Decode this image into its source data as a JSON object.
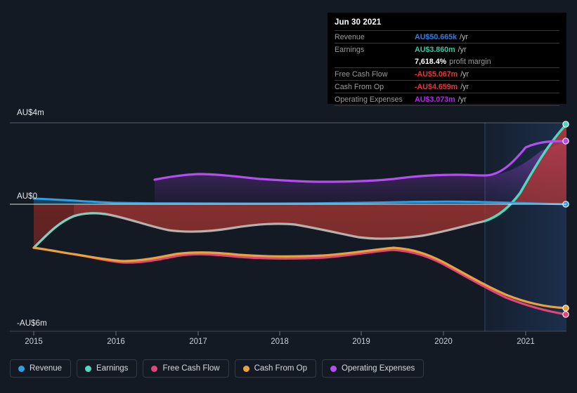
{
  "chart_data": {
    "type": "area",
    "title": "",
    "xlabel": "",
    "ylabel": "",
    "currency": "AU$",
    "grid": true,
    "legend_position": "bottom",
    "y_ticks": [
      {
        "label": "AU$4m",
        "value": 4000000
      },
      {
        "label": "AU$0",
        "value": 0
      },
      {
        "label": "-AU$6m",
        "value": -6000000
      }
    ],
    "ylim": [
      -6000000,
      4000000
    ],
    "x_ticks": [
      "2015",
      "2016",
      "2017",
      "2018",
      "2019",
      "2020",
      "2021"
    ],
    "xlim": [
      "2015",
      "2021.5"
    ],
    "forecast_region": {
      "from": "2020.72",
      "to": "2021.5",
      "shaded": true
    },
    "series": [
      {
        "name": "Revenue",
        "color": "#2e9fe0",
        "fill": "#2e9fe0",
        "points": [
          {
            "x": 2015.0,
            "y": 0.28
          },
          {
            "x": 2015.5,
            "y": 0.2
          },
          {
            "x": 2016.0,
            "y": 0.05
          },
          {
            "x": 2017.0,
            "y": 0.03
          },
          {
            "x": 2018.0,
            "y": 0.03
          },
          {
            "x": 2019.0,
            "y": 0.04
          },
          {
            "x": 2019.5,
            "y": 0.06
          },
          {
            "x": 2020.0,
            "y": 0.08
          },
          {
            "x": 2020.5,
            "y": 0.07
          },
          {
            "x": 2021.0,
            "y": 0.05
          },
          {
            "x": 2021.5,
            "y": 0.05
          }
        ]
      },
      {
        "name": "Earnings",
        "color": "#4ed8c0",
        "fill": "#b7302e",
        "points": [
          {
            "x": 2015.0,
            "y": -2.55
          },
          {
            "x": 2015.6,
            "y": -1.4
          },
          {
            "x": 2016.0,
            "y": -1.2
          },
          {
            "x": 2016.5,
            "y": -1.48
          },
          {
            "x": 2017.0,
            "y": -1.6
          },
          {
            "x": 2017.5,
            "y": -1.5
          },
          {
            "x": 2018.0,
            "y": -1.38
          },
          {
            "x": 2018.5,
            "y": -1.3
          },
          {
            "x": 2019.0,
            "y": -1.46
          },
          {
            "x": 2019.5,
            "y": -1.62
          },
          {
            "x": 2020.0,
            "y": -1.7
          },
          {
            "x": 2020.4,
            "y": -1.58
          },
          {
            "x": 2020.8,
            "y": -1.1
          },
          {
            "x": 2021.1,
            "y": 0.6
          },
          {
            "x": 2021.5,
            "y": 3.86
          }
        ]
      },
      {
        "name": "Free Cash Flow",
        "color": "#e0457b",
        "fill": "#e0457b",
        "points": [
          {
            "x": 2015.4,
            "y": -2.7
          },
          {
            "x": 2016.0,
            "y": -3.0
          },
          {
            "x": 2016.6,
            "y": -2.55
          },
          {
            "x": 2017.0,
            "y": -2.5
          },
          {
            "x": 2017.5,
            "y": -2.72
          },
          {
            "x": 2018.0,
            "y": -2.78
          },
          {
            "x": 2018.5,
            "y": -2.74
          },
          {
            "x": 2019.0,
            "y": -2.7
          },
          {
            "x": 2019.5,
            "y": -2.52
          },
          {
            "x": 2020.0,
            "y": -2.6
          },
          {
            "x": 2020.5,
            "y": -3.3
          },
          {
            "x": 2021.0,
            "y": -4.3
          },
          {
            "x": 2021.5,
            "y": -5.07
          }
        ]
      },
      {
        "name": "Cash From Op",
        "color": "#e8a33d",
        "fill": "#e8a33d",
        "points": [
          {
            "x": 2015.0,
            "y": -2.55
          },
          {
            "x": 2015.5,
            "y": -2.72
          },
          {
            "x": 2016.0,
            "y": -2.92
          },
          {
            "x": 2016.6,
            "y": -2.48
          },
          {
            "x": 2017.0,
            "y": -2.42
          },
          {
            "x": 2017.5,
            "y": -2.68
          },
          {
            "x": 2018.0,
            "y": -2.72
          },
          {
            "x": 2018.5,
            "y": -2.7
          },
          {
            "x": 2019.0,
            "y": -2.66
          },
          {
            "x": 2019.5,
            "y": -2.48
          },
          {
            "x": 2020.0,
            "y": -2.56
          },
          {
            "x": 2020.5,
            "y": -3.22
          },
          {
            "x": 2021.0,
            "y": -4.18
          },
          {
            "x": 2021.5,
            "y": -4.66
          }
        ]
      },
      {
        "name": "Operating Expenses",
        "color": "#b44ef0",
        "fill": "#b44ef0",
        "points": [
          {
            "x": 2016.2,
            "y": 1.02
          },
          {
            "x": 2016.7,
            "y": 1.12
          },
          {
            "x": 2017.0,
            "y": 1.08
          },
          {
            "x": 2017.5,
            "y": 0.96
          },
          {
            "x": 2018.0,
            "y": 0.92
          },
          {
            "x": 2018.5,
            "y": 0.9
          },
          {
            "x": 2019.0,
            "y": 0.9
          },
          {
            "x": 2019.4,
            "y": 1.0
          },
          {
            "x": 2019.8,
            "y": 1.0
          },
          {
            "x": 2020.2,
            "y": 0.92
          },
          {
            "x": 2020.7,
            "y": 0.9
          },
          {
            "x": 2021.0,
            "y": 1.8
          },
          {
            "x": 2021.5,
            "y": 3.07
          }
        ]
      }
    ]
  },
  "tooltip": {
    "date": "Jun 30 2021",
    "unit": "/yr",
    "rows": [
      {
        "label": "Revenue",
        "value": "AU$50.665k",
        "unit": "/yr",
        "color": "#2e7fe8"
      },
      {
        "label": "Earnings",
        "value": "AU$3.860m",
        "unit": "/yr",
        "color": "#34c8a0"
      },
      {
        "label": "",
        "value": "7,618.4%",
        "unit": "",
        "note": "profit margin",
        "color": "#ffffff"
      },
      {
        "label": "Free Cash Flow",
        "value": "-AU$5.067m",
        "unit": "/yr",
        "color": "#e33b3b"
      },
      {
        "label": "Cash From Op",
        "value": "-AU$4.659m",
        "unit": "/yr",
        "color": "#e33b3b"
      },
      {
        "label": "Operating Expenses",
        "value": "AU$3.073m",
        "unit": "/yr",
        "color": "#b02ce8"
      }
    ]
  },
  "legend": {
    "items": [
      {
        "label": "Revenue",
        "color": "#2e9fe0"
      },
      {
        "label": "Earnings",
        "color": "#4ed8c0"
      },
      {
        "label": "Free Cash Flow",
        "color": "#e0457b"
      },
      {
        "label": "Cash From Op",
        "color": "#e8a33d"
      },
      {
        "label": "Operating Expenses",
        "color": "#b44ef0"
      }
    ]
  },
  "axes": {
    "y_top": "AU$4m",
    "y_mid": "AU$0",
    "y_bottom": "-AU$6m",
    "x": [
      "2015",
      "2016",
      "2017",
      "2018",
      "2019",
      "2020",
      "2021"
    ]
  }
}
